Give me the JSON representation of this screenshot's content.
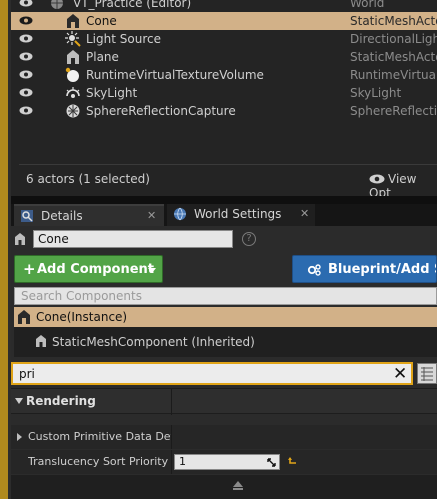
{
  "outliner": {
    "rows": [
      {
        "label": "VT_Practice (Editor)",
        "type": "World",
        "icon": "world-icon"
      },
      {
        "label": "Cone",
        "type": "StaticMeshActor",
        "icon": "static-mesh-icon",
        "selected": true
      },
      {
        "label": "Light Source",
        "type": "DirectionalLight",
        "icon": "directional-light-icon"
      },
      {
        "label": "Plane",
        "type": "StaticMeshActor",
        "icon": "static-mesh-icon"
      },
      {
        "label": "RuntimeVirtualTextureVolume",
        "type": "RuntimeVirtualT",
        "icon": "sphere-icon"
      },
      {
        "label": "SkyLight",
        "type": "SkyLight",
        "icon": "skylight-icon"
      },
      {
        "label": "SphereReflectionCapture",
        "type": "SphereReflection",
        "icon": "reflection-capture-icon"
      }
    ],
    "actor_count": "6 actors (1 selected)",
    "view_options": "View Opt"
  },
  "tabs": [
    {
      "label": "Details",
      "close": "✕"
    },
    {
      "label": "World Settings",
      "close": "✕"
    }
  ],
  "details": {
    "actor_name": "Cone",
    "help": "?",
    "add_component": "Add Component",
    "add_plus": "+",
    "blueprint": "Blueprint/Add Sc",
    "search_components_placeholder": "Search Components",
    "selected_component": "Cone(Instance)",
    "child_component": "StaticMeshComponent (Inherited)",
    "property_search": "pri",
    "clear": "✕",
    "category": "Rendering",
    "properties": [
      {
        "label": "Custom Primitive Data Defau",
        "value": ""
      },
      {
        "label": "Translucency Sort Priority",
        "value": "1"
      }
    ]
  },
  "colors": {
    "selection": "#d2b188",
    "add_component": "#52a447",
    "blueprint": "#2b6bb0",
    "search_focus": "#e0a418"
  }
}
